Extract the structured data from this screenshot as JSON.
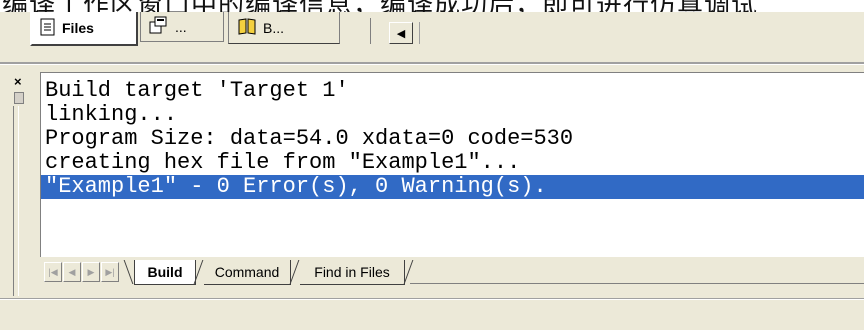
{
  "top_text": "编译工作区窗口中的编译信息，编译成功后，即可进行仿真调试",
  "workspace_tabs": [
    {
      "label": "Files",
      "icon": "document-icon",
      "active": true
    },
    {
      "label": "...",
      "icon": "register-icon",
      "active": false
    },
    {
      "label": "B...",
      "icon": "books-icon",
      "active": false
    }
  ],
  "workspace_scroll": {
    "left_arrow": "◀"
  },
  "output": {
    "close_glyph": "×",
    "lines": [
      "Build target 'Target 1'",
      "linking...",
      "Program Size: data=54.0 xdata=0 code=530",
      "creating hex file from \"Example1\"...",
      "\"Example1\" - 0 Error(s), 0 Warning(s)."
    ],
    "highlight_index": 4
  },
  "output_tabs": [
    {
      "label": "Build",
      "active": true
    },
    {
      "label": "Command",
      "active": false
    },
    {
      "label": "Find in Files",
      "active": false
    }
  ],
  "nav_buttons": [
    "first",
    "prev",
    "next",
    "last"
  ],
  "colors": {
    "highlight": "#316ac5",
    "background": "#ece9d8"
  }
}
